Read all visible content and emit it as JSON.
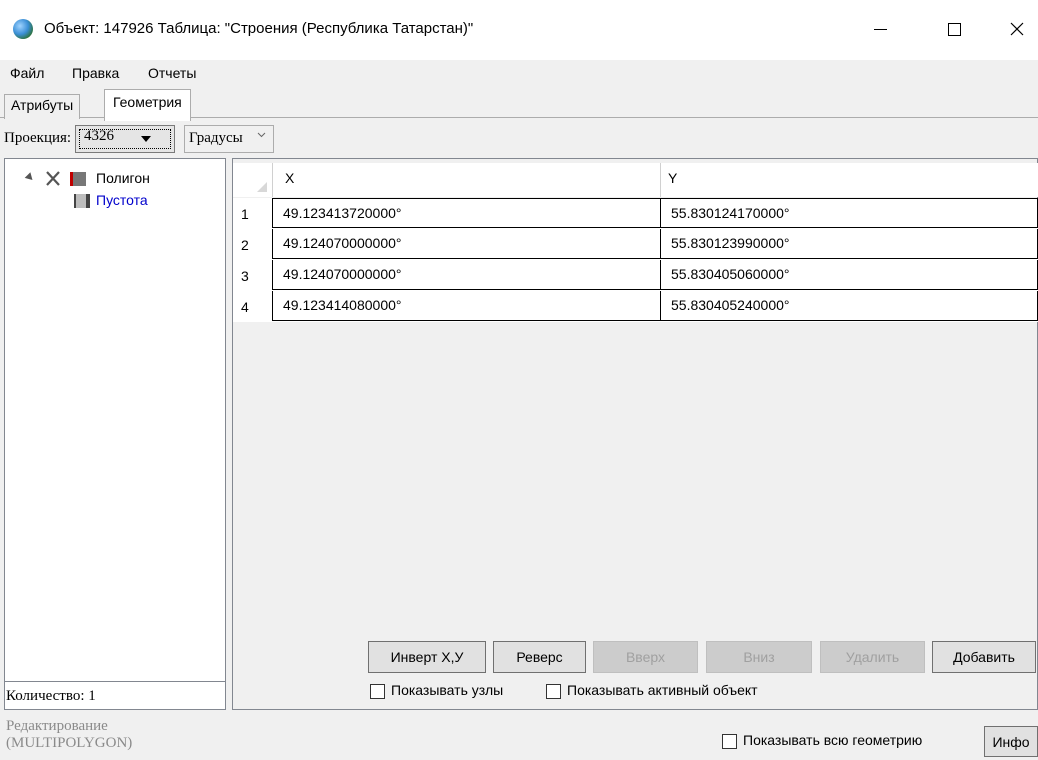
{
  "window": {
    "title": "Объект: 147926 Таблица: \"Строения (Республика Татарстан)\""
  },
  "menu": {
    "file": "Файл",
    "edit": "Правка",
    "reports": "Отчеты"
  },
  "tabs": {
    "attributes": "Атрибуты",
    "geometry": "Геометрия"
  },
  "projection": {
    "label": "Проекция:",
    "value": "4326",
    "units": "Градусы"
  },
  "tree": {
    "polygon": "Полигон",
    "void": "Пустота",
    "count": "Количество: 1"
  },
  "grid": {
    "columns": {
      "x": "X",
      "y": "Y"
    },
    "rows": [
      {
        "n": "1",
        "x": "49.123413720000°",
        "y": "55.830124170000°"
      },
      {
        "n": "2",
        "x": "49.124070000000°",
        "y": "55.830123990000°"
      },
      {
        "n": "3",
        "x": "49.124070000000°",
        "y": "55.830405060000°"
      },
      {
        "n": "4",
        "x": "49.123414080000°",
        "y": "55.830405240000°"
      }
    ]
  },
  "buttons": {
    "invert": "Инверт X,У",
    "reverse": "Реверс",
    "up": "Вверх",
    "down": "Вниз",
    "delete": "Удалить",
    "add": "Добавить",
    "info": "Инфо"
  },
  "options": {
    "show_nodes": "Показывать узлы",
    "show_active": "Показывать активный объект",
    "show_all_geometry": "Показывать всю геометрию"
  },
  "status": {
    "line1": "Редактирование",
    "line2": "(MULTIPOLYGON)"
  },
  "colors": {
    "void_link": "#0000cc",
    "polygon_marker": "#c00000"
  }
}
